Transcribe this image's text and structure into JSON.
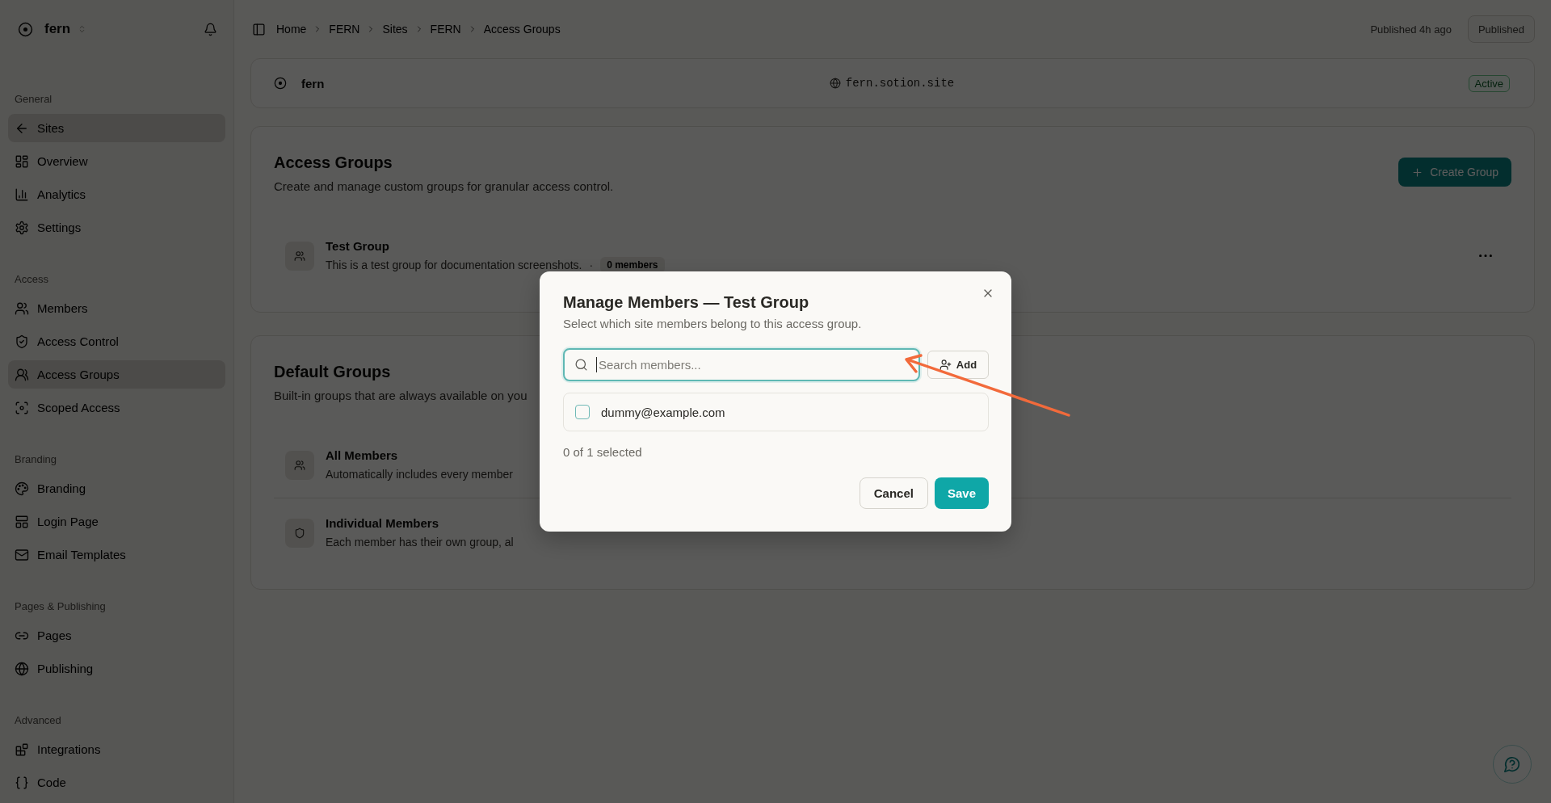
{
  "sidebar": {
    "workspace": "fern",
    "sections": [
      {
        "label": "General",
        "items": [
          {
            "label": "Sites",
            "selected": true
          },
          {
            "label": "Overview",
            "selected": false
          },
          {
            "label": "Analytics",
            "selected": false
          },
          {
            "label": "Settings",
            "selected": false
          }
        ]
      },
      {
        "label": "Access",
        "items": [
          {
            "label": "Members",
            "selected": false
          },
          {
            "label": "Access Control",
            "selected": false
          },
          {
            "label": "Access Groups",
            "selected": true
          },
          {
            "label": "Scoped Access",
            "selected": false
          }
        ]
      },
      {
        "label": "Branding",
        "items": [
          {
            "label": "Branding",
            "selected": false
          },
          {
            "label": "Login Page",
            "selected": false
          },
          {
            "label": "Email Templates",
            "selected": false
          }
        ]
      },
      {
        "label": "Pages & Publishing",
        "items": [
          {
            "label": "Pages",
            "selected": false
          },
          {
            "label": "Publishing",
            "selected": false
          }
        ]
      },
      {
        "label": "Advanced",
        "items": [
          {
            "label": "Integrations",
            "selected": false
          },
          {
            "label": "Code",
            "selected": false
          }
        ]
      }
    ]
  },
  "topbar": {
    "breadcrumb": [
      "Home",
      "FERN",
      "Sites",
      "FERN",
      "Access Groups"
    ],
    "status": "Published 4h ago",
    "publish_button": {
      "label": "Published",
      "disabled": true
    }
  },
  "site_card": {
    "name": "fern",
    "domain": "fern.sotion.site",
    "status": "Active"
  },
  "access_groups": {
    "title": "Access Groups",
    "subtitle": "Create and manage custom groups for granular access control.",
    "create_button": "Create Group",
    "groups": [
      {
        "name": "Test Group",
        "description": "This is a test group for documentation screenshots.",
        "separator": "·",
        "member_count": "0 members"
      }
    ]
  },
  "default_groups": {
    "title": "Default Groups",
    "subtitle": "Built-in groups that are always available on you",
    "groups": [
      {
        "name": "All Members",
        "description": "Automatically includes every member"
      },
      {
        "name": "Individual Members",
        "description": "Each member has their own group, al"
      }
    ]
  },
  "dialog": {
    "title": "Manage Members — Test Group",
    "subtitle": "Select which site members belong to this access group.",
    "search": {
      "placeholder": "Search members...",
      "focused": true
    },
    "add_button": "Add",
    "members": [
      {
        "email": "dummy@example.com",
        "checked": false
      }
    ],
    "selection_summary": "0 of 1 selected",
    "cancel_button": "Cancel",
    "save_button": "Save"
  }
}
